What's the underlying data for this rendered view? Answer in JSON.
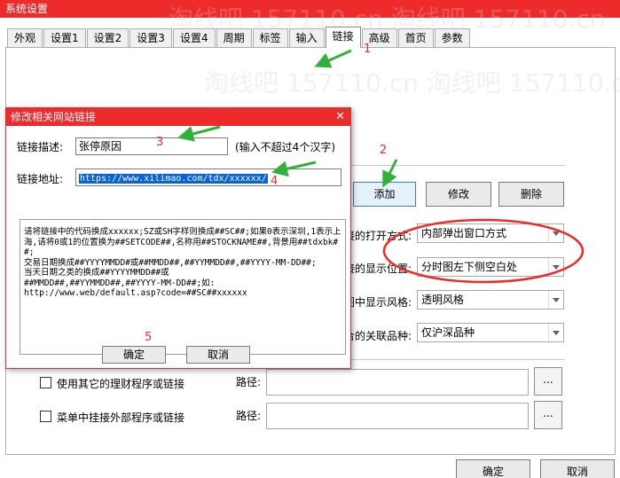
{
  "window": {
    "title": "系统设置"
  },
  "tabs": [
    "外观",
    "设置1",
    "设置2",
    "设置3",
    "设置4",
    "周期",
    "标签",
    "输入",
    "链接",
    "高级",
    "首页",
    "参数"
  ],
  "active_tab": "链接",
  "panel": {
    "add_label": "添加",
    "modify_label": "修改",
    "delete_label": "删除",
    "open_mode_label": "链接的打开方式:",
    "open_mode_visible": "接的打开方式:",
    "open_mode_value": "内部弹出窗口方式",
    "display_pos_visible": "接的显示位置:",
    "display_pos_value": "分时图左下侧空白处",
    "style_visible": "图中显示风格:",
    "style_value": "透明风格",
    "related_visible": "合的关联品种:",
    "related_value": "仅沪深品种",
    "use_other_program_label": "使用其它的理财程序或链接",
    "menu_external_label": "菜单中挂接外部程序或链接",
    "path_label": "路径:",
    "path_label_2": "路径:",
    "browse_label": "...",
    "ok_label": "确定",
    "cancel_label": "取消"
  },
  "dialog": {
    "title": "修改相关网站链接",
    "desc_label": "链接描述:",
    "desc_value": "张停原因",
    "desc_hint": "(输入不超过4个汉字)",
    "url_label": "链接地址:",
    "url_value": "https://www.xilimao.com/tdx/xxxxxx/",
    "note": "请将链接中的代码换成xxxxxx;SZ或SH字样则换成##SC##;如果0表示深圳,1表示上海,请将0或1的位置换为##SETCODE##,名称用##STOCKNAME##,背景用##tdxbk##;\n交易日期换成##YYYYMMDD#或##MMDD##,##YYMMDD##,##YYYY-MM-DD##;\n当天日期之类的换成##YYYYMMDD##或\n##MMDD##,##YYMMDD##,##YYYY-MM-DD##;如:\nhttp://www.web/default.asp?code=##SC##xxxxxx",
    "ok_label": "确定",
    "cancel_label": "取消"
  },
  "annotations": {
    "n1": "1",
    "n2": "2",
    "n3": "3",
    "n4": "4",
    "n5": "5"
  },
  "watermark": {
    "text": "淘线吧 157110.cn 淘线吧 157110.cn"
  },
  "colors": {
    "title_red": "#ee2b2b",
    "annotation_red": "#ee2b2b",
    "arrow_green": "#2fb13a",
    "selection_blue": "#0a63d6"
  }
}
